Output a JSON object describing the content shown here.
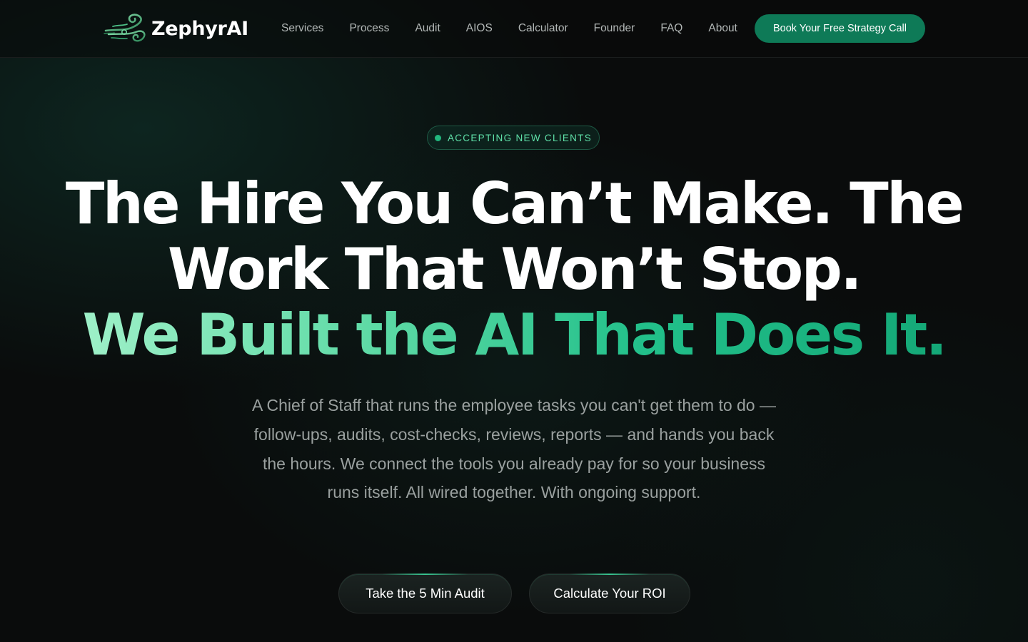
{
  "brand": {
    "name": "ZephyrAI",
    "logo_icon": "wind-swirl-logo"
  },
  "nav": {
    "items": [
      {
        "label": "Services"
      },
      {
        "label": "Process"
      },
      {
        "label": "Audit"
      },
      {
        "label": "AIOS"
      },
      {
        "label": "Calculator"
      },
      {
        "label": "Founder"
      },
      {
        "label": "FAQ"
      },
      {
        "label": "About"
      }
    ],
    "cta_label": "Book Your Free Strategy Call"
  },
  "hero": {
    "badge": "ACCEPTING NEW CLIENTS",
    "headline": {
      "line1": "The Hire You Can’t Make. The",
      "line2": "Work That Won’t Stop.",
      "accent": "We Built the AI That Does It."
    },
    "subcopy": "A Chief of Staff that runs the employee tasks you can't get them to do — follow-ups, audits, cost-checks, reviews, reports — and hands you back the hours. We connect the tools you already pay for so your business runs itself. All wired together. With ongoing support.",
    "buttons": {
      "audit_label": "Take the 5 Min Audit",
      "roi_label": "Calculate Your ROI"
    }
  },
  "colors": {
    "accent": "#0e7a57",
    "accent_text": "#5fe0a8",
    "background": "#0a0c0c"
  }
}
